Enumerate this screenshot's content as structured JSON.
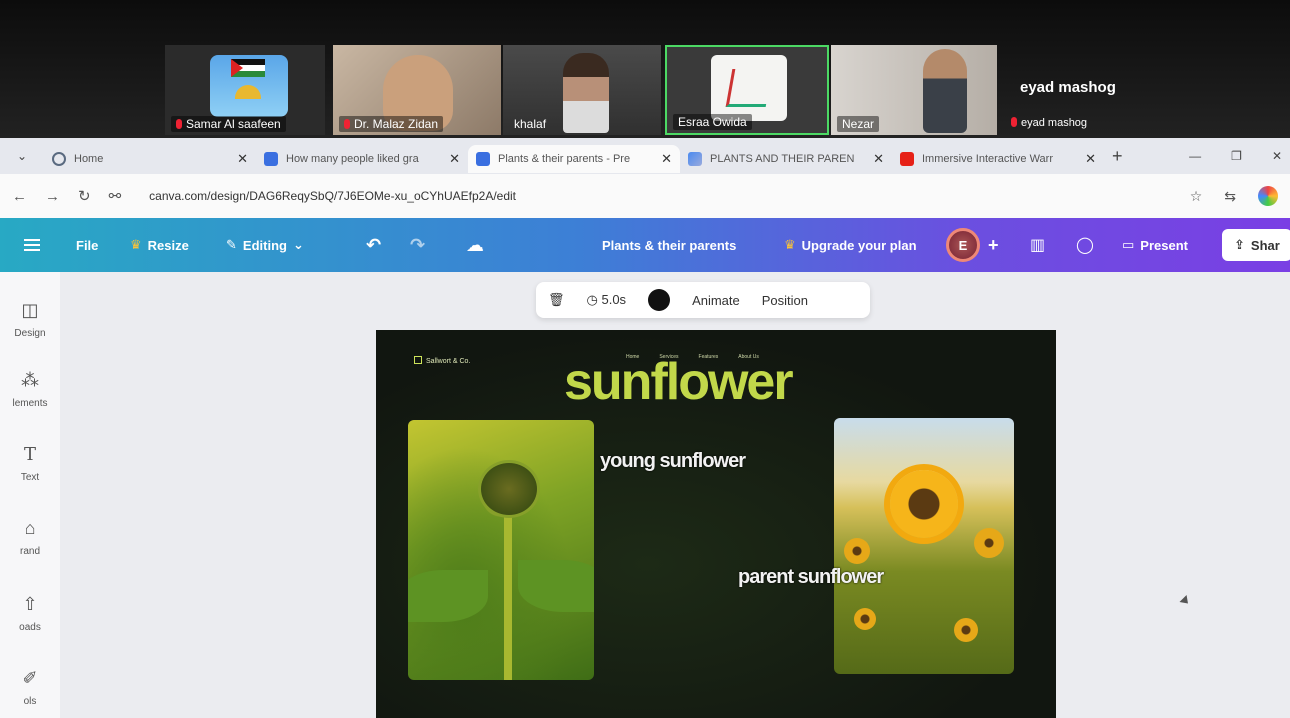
{
  "call": {
    "participants": [
      {
        "name": "Samar Al saafeen"
      },
      {
        "name": "Dr. Malaz Zidan"
      },
      {
        "name": "khalaf"
      },
      {
        "name": "Esraa Owida"
      },
      {
        "name": "Nezar"
      },
      {
        "name": "eyad mashog",
        "display_name": "eyad mashog"
      }
    ],
    "active_color": "#4cd964"
  },
  "browser": {
    "tabs": [
      {
        "title": "Home",
        "icon": "home-icon"
      },
      {
        "title": "How many people liked gra",
        "icon": "canva-icon"
      },
      {
        "title": "Plants & their parents - Pre",
        "icon": "canva-icon",
        "active": true
      },
      {
        "title": "PLANTS AND THEIR PAREN",
        "icon": "docs-icon"
      },
      {
        "title": "Immersive Interactive Warr",
        "icon": "youtube-icon"
      }
    ],
    "url": "canva.com/design/DAG6ReqySbQ/7J6EOMe-xu_oCYhUAEfp2A/edit"
  },
  "canva": {
    "file": "File",
    "resize": "Resize",
    "editing": "Editing",
    "doc_title": "Plants & their parents",
    "upgrade": "Upgrade your plan",
    "present": "Present",
    "share": "Shar",
    "avatar_letter": "E",
    "side": [
      "Design",
      "lements",
      "Text",
      "rand",
      "oads",
      "ols"
    ],
    "ctx": {
      "duration": "5.0s",
      "animate": "Animate",
      "position": "Position"
    }
  },
  "slide": {
    "brand": "Sallwort & Co.",
    "menu": [
      "Home",
      "Services",
      "Features",
      "About Us"
    ],
    "title": "sunflower",
    "young_label": "young sunflower",
    "parent_label": "parent sunflower",
    "title_color": "#c2d84a"
  }
}
